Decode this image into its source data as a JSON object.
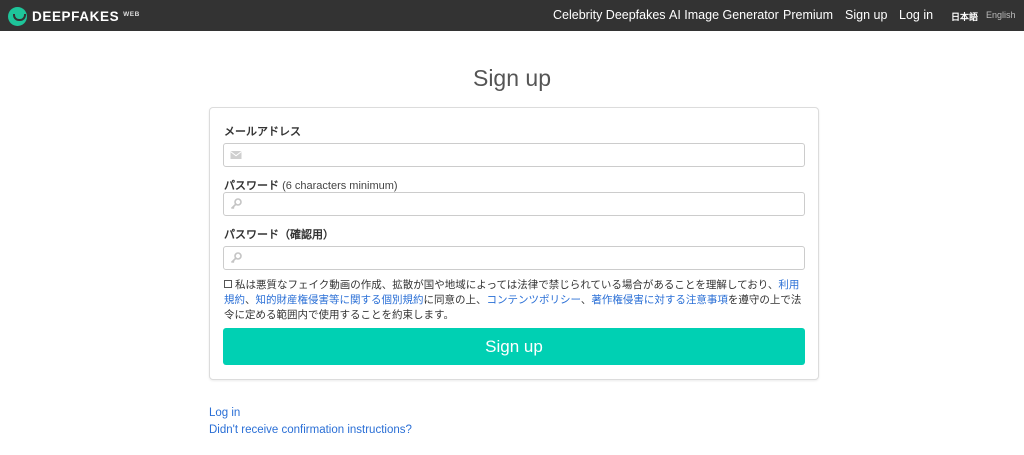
{
  "nav": {
    "brand_name": "DEEPFAKES",
    "brand_sub": "WEB",
    "items": [
      {
        "label": "Celebrity Deepfakes"
      },
      {
        "label": "AI Image Generator"
      },
      {
        "label": "Premium"
      },
      {
        "label": "Sign up"
      },
      {
        "label": "Log in"
      }
    ],
    "lang_ja": "日本語",
    "lang_en": "English"
  },
  "page": {
    "title": "Sign up"
  },
  "form": {
    "email_label": "メールアドレス",
    "email_value": "",
    "password_label": "パスワード",
    "password_hint": "(6 characters minimum)",
    "password_value": "",
    "password_confirm_label": "パスワード（確認用）",
    "password_confirm_value": "",
    "terms": {
      "checked": false,
      "text1": "私は悪質なフェイク動画の作成、拡散が国や地域によっては法律で禁じられている場合があることを理解しており、",
      "link1": "利用規約",
      "sep1": "、",
      "link2": "知的財産権侵害等に関する個別規約",
      "text2": "に同意の上、",
      "link3": "コンテンツポリシー",
      "sep2": "、",
      "link4": "著作権侵害に対する注意事項",
      "text3": "を遵守の上で法令に定める範囲内で使用することを約束します。"
    },
    "submit_label": "Sign up"
  },
  "footer_links": {
    "login": "Log in",
    "confirmation": "Didn't receive confirmation instructions?"
  },
  "colors": {
    "navbar_bg": "#333333",
    "brand_green": "#1ec59a",
    "submit_bg": "#00d0b3",
    "link": "#2a6fd6"
  },
  "icons": {
    "brand": "smile-logo-icon",
    "email": "envelope-icon",
    "password": "key-icon",
    "password_confirm": "key-icon"
  }
}
